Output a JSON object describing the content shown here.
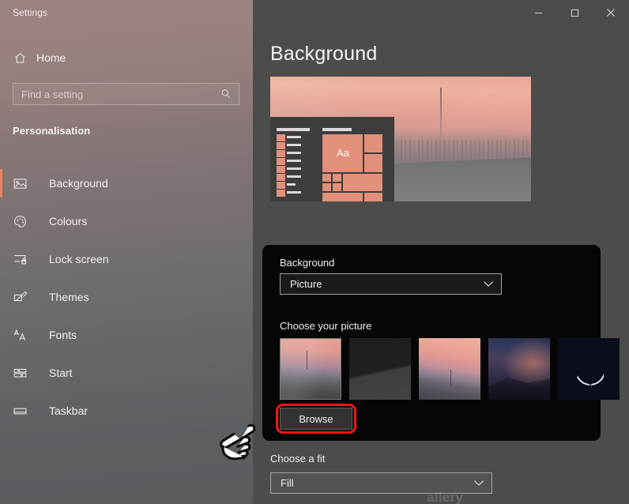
{
  "window": {
    "app_title": "Settings",
    "titlebar_buttons": [
      {
        "name": "minimize",
        "glyph": "minimise-icon"
      },
      {
        "name": "maximize",
        "glyph": "maximise-icon"
      },
      {
        "name": "close",
        "glyph": "close-icon"
      }
    ]
  },
  "sidebar": {
    "home_label": "Home",
    "home_icon": "home-icon",
    "search": {
      "placeholder": "Find a setting",
      "value": "",
      "icon": "search-icon"
    },
    "section_header": "Personalisation",
    "accent_color": "#e8825f",
    "items": [
      {
        "label": "Background",
        "icon": "picture-icon",
        "active": true
      },
      {
        "label": "Colours",
        "icon": "palette-icon",
        "active": false
      },
      {
        "label": "Lock screen",
        "icon": "lock-screen-icon",
        "active": false
      },
      {
        "label": "Themes",
        "icon": "brush-icon",
        "active": false
      },
      {
        "label": "Fonts",
        "icon": "fonts-aa-icon",
        "active": false
      },
      {
        "label": "Start",
        "icon": "start-tiles-icon",
        "active": false
      },
      {
        "label": "Taskbar",
        "icon": "taskbar-icon",
        "active": false
      }
    ]
  },
  "main": {
    "page_title": "Background",
    "preview": {
      "alt": "desktop-wallpaper-preview-sunset-city",
      "sample_text": "Aa",
      "accent_tile_color": "#e2907a"
    },
    "background_section": {
      "label": "Background",
      "dropdown_value": "Picture",
      "dropdown_icon": "chevron-down-icon"
    },
    "choose_picture": {
      "label": "Choose your picture",
      "thumbnails": [
        {
          "name": "thumbnail-sunset-city",
          "selected": true
        },
        {
          "name": "thumbnail-dark-gray",
          "selected": false
        },
        {
          "name": "thumbnail-pink-sky",
          "selected": false
        },
        {
          "name": "thumbnail-blue-mountain",
          "selected": false
        },
        {
          "name": "thumbnail-crescent-moon",
          "selected": false
        }
      ],
      "browse_label": "Browse",
      "browse_highlight_color": "#f41616"
    },
    "choose_fit": {
      "label": "Choose a fit",
      "dropdown_value": "Fill",
      "dropdown_icon": "chevron-down-icon"
    }
  },
  "annotations": {
    "cursor_icon": "pointing-hand-cursor",
    "watermark_text": "allery"
  }
}
